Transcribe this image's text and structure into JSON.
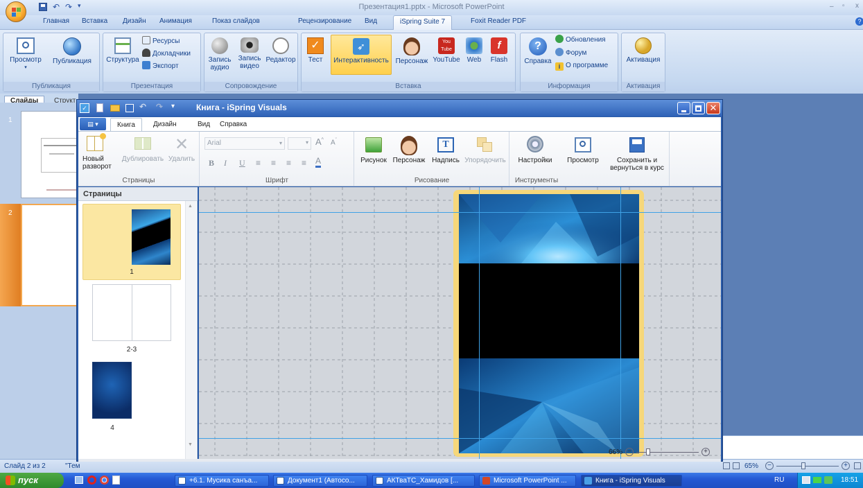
{
  "powerpoint": {
    "title": "Презентация1.pptx - Microsoft PowerPoint",
    "tabs": [
      "Главная",
      "Вставка",
      "Дизайн",
      "Анимация",
      "Показ слайдов",
      "Рецензирование",
      "Вид",
      "iSpring Suite 7",
      "Foxit Reader PDF"
    ],
    "active_tab": "iSpring Suite 7",
    "groups": {
      "publish": {
        "label": "Публикация",
        "preview": "Просмотр",
        "publish": "Публикация"
      },
      "presentation": {
        "label": "Презентация",
        "structure": "Структура",
        "resources": "Ресурсы",
        "speakers": "Докладчики",
        "export": "Экспорт"
      },
      "accompaniment": {
        "label": "Сопровождение",
        "record_audio": "Запись аудио",
        "record_video": "Запись видео",
        "editor": "Редактор"
      },
      "insert": {
        "label": "Вставка",
        "test": "Тест",
        "interactivity": "Интерактивность",
        "character": "Персонаж",
        "youtube": "YouTube",
        "web": "Web",
        "flash": "Flash"
      },
      "info": {
        "label": "Информация",
        "help": "Справка",
        "updates": "Обновления",
        "forum": "Форум",
        "about": "О программе"
      },
      "activation": {
        "label": "Активация",
        "activation": "Активация"
      }
    },
    "panel_tabs": [
      "Слайды",
      "Структ"
    ],
    "slide_numbers": [
      "1",
      "2"
    ],
    "status": {
      "slide": "Слайд 2 из 2",
      "theme": "\"Тем",
      "zoom": "65%"
    }
  },
  "ispring": {
    "title": "Книга - iSpring Visuals",
    "tabs": [
      "Книга",
      "Дизайн",
      "Вид",
      "Справка"
    ],
    "active_tab": "Книга",
    "groups": {
      "pages": {
        "label": "Страницы",
        "new_spread": "Новый разворот",
        "duplicate": "Дублировать",
        "delete": "Удалить"
      },
      "font": {
        "label": "Шрифт",
        "font_name": "Arial",
        "bold": "B",
        "italic": "I",
        "underline": "U",
        "color_letter": "A"
      },
      "drawing": {
        "label": "Рисование",
        "picture": "Рисунок",
        "character": "Персонаж",
        "caption": "Надпись",
        "order": "Упорядочить"
      },
      "tools": {
        "label": "Инструменты",
        "settings": "Настройки",
        "preview": "Просмотр",
        "save_return": "Сохранить и вернуться в курс"
      }
    },
    "pages_panel": {
      "title": "Страницы",
      "pages": [
        {
          "label": "1"
        },
        {
          "label": "2-3"
        },
        {
          "label": "4"
        }
      ]
    },
    "zoom": "66%"
  },
  "taskbar": {
    "start": "пуск",
    "tasks": [
      "+6.1. Мусика санъа...",
      "Документ1 (Автосо...",
      "АКТваТС_Хамидов [...",
      "Microsoft PowerPoint ...",
      "Книга - iSpring Visuals"
    ],
    "active_task": "Книга - iSpring Visuals",
    "lang": "RU",
    "time": "18:51"
  },
  "colors": {
    "page_border": "#f6d77a",
    "page_guide": "#3fa2e6",
    "taskbar": "#245edc",
    "ispring_title": "#2e61b6"
  }
}
